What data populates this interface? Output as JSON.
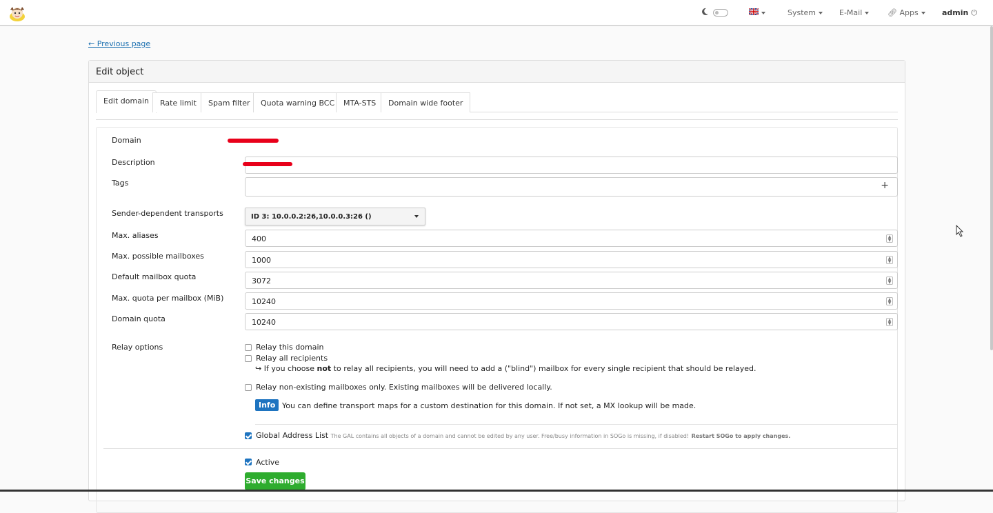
{
  "nav": {
    "system": "System",
    "email": "E-Mail",
    "apps": "Apps",
    "user": "admin"
  },
  "prev_link": "← Previous page",
  "panel_title": "Edit object",
  "tabs": [
    "Edit domain",
    "Rate limit",
    "Spam filter",
    "Quota warning BCC",
    "MTA-STS",
    "Domain wide footer"
  ],
  "form": {
    "domain_label": "Domain",
    "description_label": "Description",
    "tags_label": "Tags",
    "transport_label": "Sender-dependent transports",
    "transport_value": "ID 3: 10.0.0.2:26,10.0.0.3:26 ()",
    "max_aliases_label": "Max. aliases",
    "max_aliases": "400",
    "max_mailboxes_label": "Max. possible mailboxes",
    "max_mailboxes": "1000",
    "default_quota_label": "Default mailbox quota",
    "default_quota": "3072",
    "max_quota_label": "Max. quota per mailbox (MiB)",
    "max_quota": "10240",
    "domain_quota_label": "Domain quota",
    "domain_quota": "10240",
    "relay_label": "Relay options",
    "relay_domain": "Relay this domain",
    "relay_all": "Relay all recipients",
    "relay_hint_pre": "↪ If you choose ",
    "relay_hint_bold": "not",
    "relay_hint_post": " to relay all recipients, you will need to add a (\"blind\") mailbox for every single recipient that should be relayed.",
    "relay_nonexist": "Relay non-existing mailboxes only. Existing mailboxes will be delivered locally.",
    "info_badge": "Info",
    "info_text": "You can define transport maps for a custom destination for this domain. If not set, a MX lookup will be made.",
    "gal_label": "Global Address List",
    "gal_hint": "The GAL contains all objects of a domain and cannot be edited by any user. Free/busy information in SOGo is missing, if disabled!",
    "gal_restart": "Restart SOGo to apply changes.",
    "active_label": "Active",
    "save_label": "Save changes"
  },
  "colors": {
    "accent": "#1e74c0",
    "save": "#2eac2e",
    "redaction": "#e8001a"
  }
}
